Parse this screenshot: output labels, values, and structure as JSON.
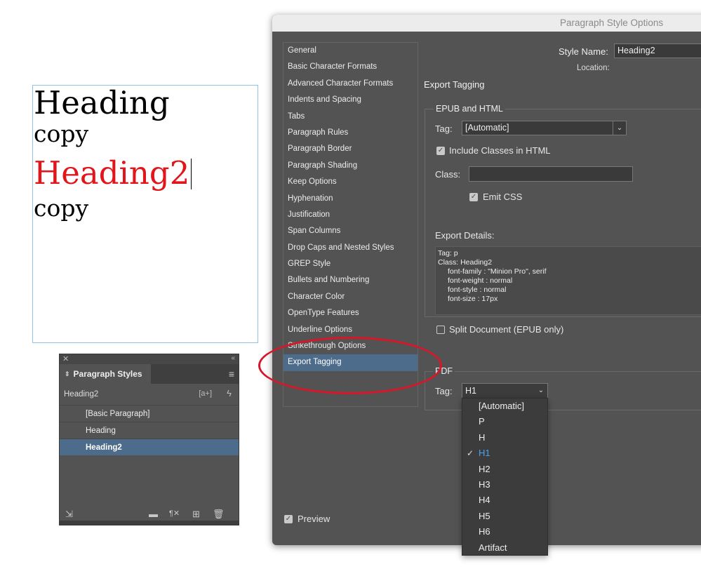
{
  "document": {
    "lines": [
      "Heading",
      "copy",
      "Heading2",
      "copy"
    ],
    "heading2_color": "#e0161b",
    "frame_color": "#8fc4e8"
  },
  "paragraph_styles_panel": {
    "tab_label": "Paragraph Styles",
    "current_style": "Heading2",
    "plus_label": "[a+]",
    "styles": [
      "[Basic Paragraph]",
      "Heading",
      "Heading2"
    ],
    "selected_style": "Heading2",
    "icons": [
      "load-styles-icon",
      "folder-icon",
      "clear-overrides-icon",
      "new-style-icon",
      "trash-icon"
    ]
  },
  "dialog": {
    "title": "Paragraph Style Options",
    "style_name_label": "Style Name:",
    "style_name_value": "Heading2",
    "location_label": "Location:",
    "categories": [
      "General",
      "Basic Character Formats",
      "Advanced Character Formats",
      "Indents and Spacing",
      "Tabs",
      "Paragraph Rules",
      "Paragraph Border",
      "Paragraph Shading",
      "Keep Options",
      "Hyphenation",
      "Justification",
      "Span Columns",
      "Drop Caps and Nested Styles",
      "GREP Style",
      "Bullets and Numbering",
      "Character Color",
      "OpenType Features",
      "Underline Options",
      "Strikethrough Options",
      "Export Tagging"
    ],
    "selected_category": "Export Tagging",
    "section_title": "Export Tagging",
    "epub": {
      "legend": "EPUB and HTML",
      "tag_label": "Tag:",
      "tag_value": "[Automatic]",
      "include_classes_label": "Include Classes in HTML",
      "include_classes_checked": true,
      "class_label": "Class:",
      "class_value": "",
      "emit_css_label": "Emit CSS",
      "emit_css_checked": true,
      "export_details_label": "Export Details:",
      "export_details_lines": [
        "Tag: p",
        "Class: Heading2",
        "font-family : \"Minion Pro\", serif",
        "font-weight : normal",
        "font-style : normal",
        "font-size : 17px"
      ],
      "split_document_label": "Split Document (EPUB only)",
      "split_document_checked": false
    },
    "pdf": {
      "legend": "PDF",
      "tag_label": "Tag:",
      "tag_value": "H1",
      "options": [
        "[Automatic]",
        "P",
        "H",
        "H1",
        "H2",
        "H3",
        "H4",
        "H5",
        "H6",
        "Artifact"
      ],
      "checked_option": "H1"
    },
    "preview_label": "Preview",
    "preview_checked": true,
    "highlight_color": "#d8162a",
    "selection_color": "#4d6b8a"
  }
}
